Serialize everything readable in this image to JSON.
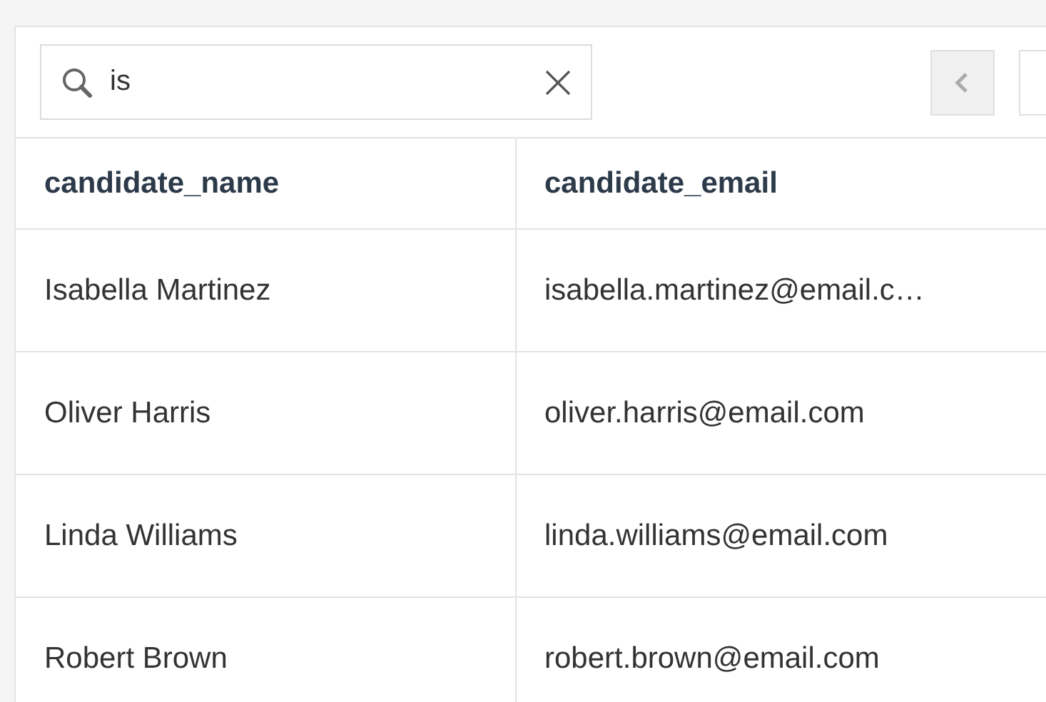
{
  "search": {
    "value": "is"
  },
  "table": {
    "columns": [
      "candidate_name",
      "candidate_email"
    ],
    "rows": [
      {
        "candidate_name": "Isabella Martinez",
        "candidate_email": "isabella.martinez@email.c…"
      },
      {
        "candidate_name": "Oliver Harris",
        "candidate_email": "oliver.harris@email.com"
      },
      {
        "candidate_name": "Linda Williams",
        "candidate_email": "linda.williams@email.com"
      },
      {
        "candidate_name": "Robert Brown",
        "candidate_email": "robert.brown@email.com"
      }
    ]
  }
}
